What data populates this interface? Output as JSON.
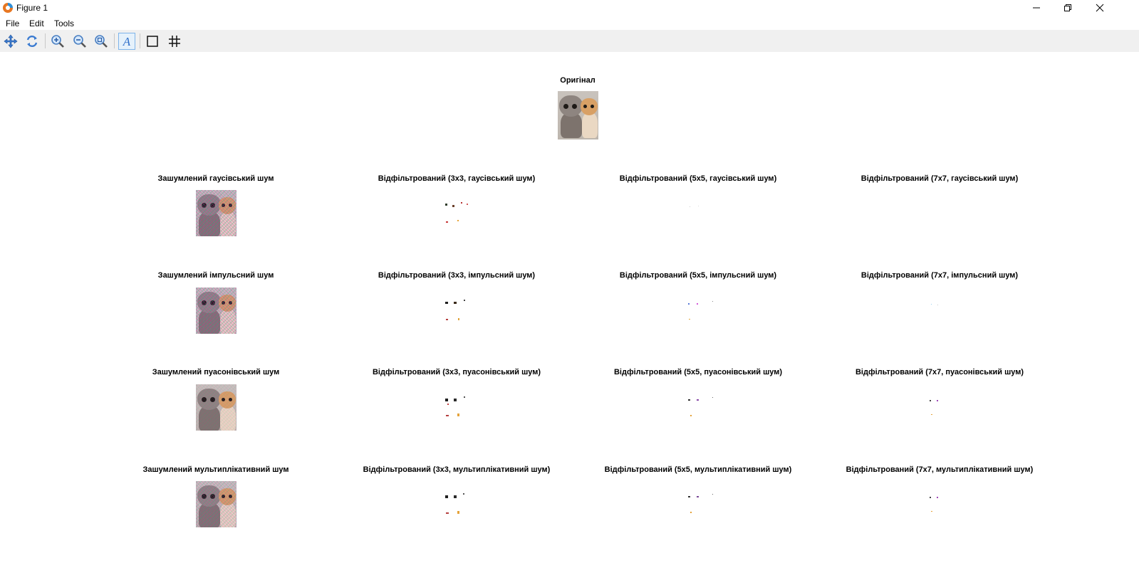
{
  "window": {
    "title": "Figure 1"
  },
  "menu": {
    "file": "File",
    "edit": "Edit",
    "tools": "Tools"
  },
  "toolbar": {
    "buttons": [
      "pan-icon",
      "rotate-icon",
      "zoom-in-icon",
      "zoom-out-icon",
      "zoom-reset-icon",
      "text-icon",
      "box-icon",
      "grid-icon"
    ]
  },
  "figure": {
    "original_title": "Оригінал",
    "rows": [
      {
        "noisy": "Зашумлений гаусівський шум",
        "f3": "Відфільтрований (3x3, гаусівський шум)",
        "f5": "Відфільтрований (5x5, гаусівський шум)",
        "f7": "Відфільтрований (7x7, гаусівський шум)"
      },
      {
        "noisy": "Зашумлений імпульсний шум",
        "f3": "Відфільтрований (3x3, імпульсний шум)",
        "f5": "Відфільтрований (5x5, імпульсний шум)",
        "f7": "Відфільтрований (7x7, імпульсний шум)"
      },
      {
        "noisy": "Зашумлений пуасонівський шум",
        "f3": "Відфільтрований (3x3, пуасонівський шум)",
        "f5": "Відфільтрований (5x5, пуасонівський шум)",
        "f7": "Відфільтрований (7x7, пуасонівський шум)"
      },
      {
        "noisy": "Зашумлений мультиплікативний шум",
        "f3": "Відфільтрований (3x3, мультиплікативний шум)",
        "f5": "Відфільтрований (5x5, мультиплікативний шум)",
        "f7": "Відфільтрований (7x7, мультиплікативний шум)"
      }
    ]
  },
  "colors": {
    "toolbar_bg": "#f0f0f0",
    "accent": "#2f6fc9"
  }
}
